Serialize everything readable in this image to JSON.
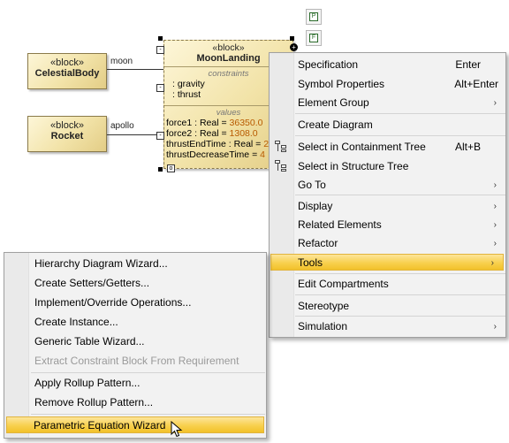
{
  "diagram": {
    "celestial": {
      "stereotype": "«block»",
      "name": "CelestialBody"
    },
    "rocket": {
      "stereotype": "«block»",
      "name": "Rocket"
    },
    "moonlanding": {
      "stereotype": "«block»",
      "name": "MoonLanding",
      "constraints_title": "constraints",
      "constraints": [
        ": gravity",
        ": thrust"
      ],
      "values_title": "values",
      "values": [
        {
          "name": "force1",
          "type": " : Real = ",
          "value": "36350.0"
        },
        {
          "name": "force2",
          "type": " : Real = ",
          "value": "1308.0"
        },
        {
          "name": "thrustEndTime",
          "type": " : Real = ",
          "value": "2"
        },
        {
          "name": "thrustDecreaseTime",
          "type": " = ",
          "value": "4"
        }
      ]
    },
    "roles": {
      "moon": "moon",
      "apollo": "apollo"
    },
    "side_buttons": [
      "P",
      "F"
    ]
  },
  "context_menu": {
    "items": [
      {
        "label": "Specification",
        "shortcut": "Enter"
      },
      {
        "label": "Symbol Properties",
        "shortcut": "Alt+Enter"
      },
      {
        "label": "Element Group",
        "submenu": "›"
      },
      {
        "label": "Create Diagram"
      },
      {
        "label": "Select in Containment Tree",
        "shortcut": "Alt+B",
        "icon": "containment-tree-icon"
      },
      {
        "label": "Select in Structure Tree",
        "icon": "structure-tree-icon"
      },
      {
        "label": "Go To",
        "submenu": "›"
      },
      {
        "label": "Display",
        "submenu": "›"
      },
      {
        "label": "Related Elements",
        "submenu": "›"
      },
      {
        "label": "Refactor",
        "submenu": "›"
      },
      {
        "label": "Tools",
        "submenu": "›",
        "highlighted": true
      },
      {
        "label": "Edit Compartments"
      },
      {
        "label": "Stereotype"
      },
      {
        "label": "Simulation",
        "submenu": "›"
      }
    ]
  },
  "tools_menu": {
    "items": [
      {
        "label": "Hierarchy Diagram Wizard..."
      },
      {
        "label": "Create Setters/Getters..."
      },
      {
        "label": "Implement/Override Operations..."
      },
      {
        "label": "Create Instance..."
      },
      {
        "label": "Generic Table Wizard..."
      },
      {
        "label": "Extract Constraint Block From Requirement",
        "disabled": true
      },
      {
        "label": "Apply Rollup Pattern..."
      },
      {
        "label": "Remove Rollup Pattern..."
      },
      {
        "label": "Parametric Equation Wizard",
        "highlighted": true
      }
    ]
  },
  "colors": {
    "highlight": "#f8d04e",
    "block_fill": "#f2e3a8",
    "value_text": "#b85a00",
    "disabled_text": "#9a9a9a"
  }
}
